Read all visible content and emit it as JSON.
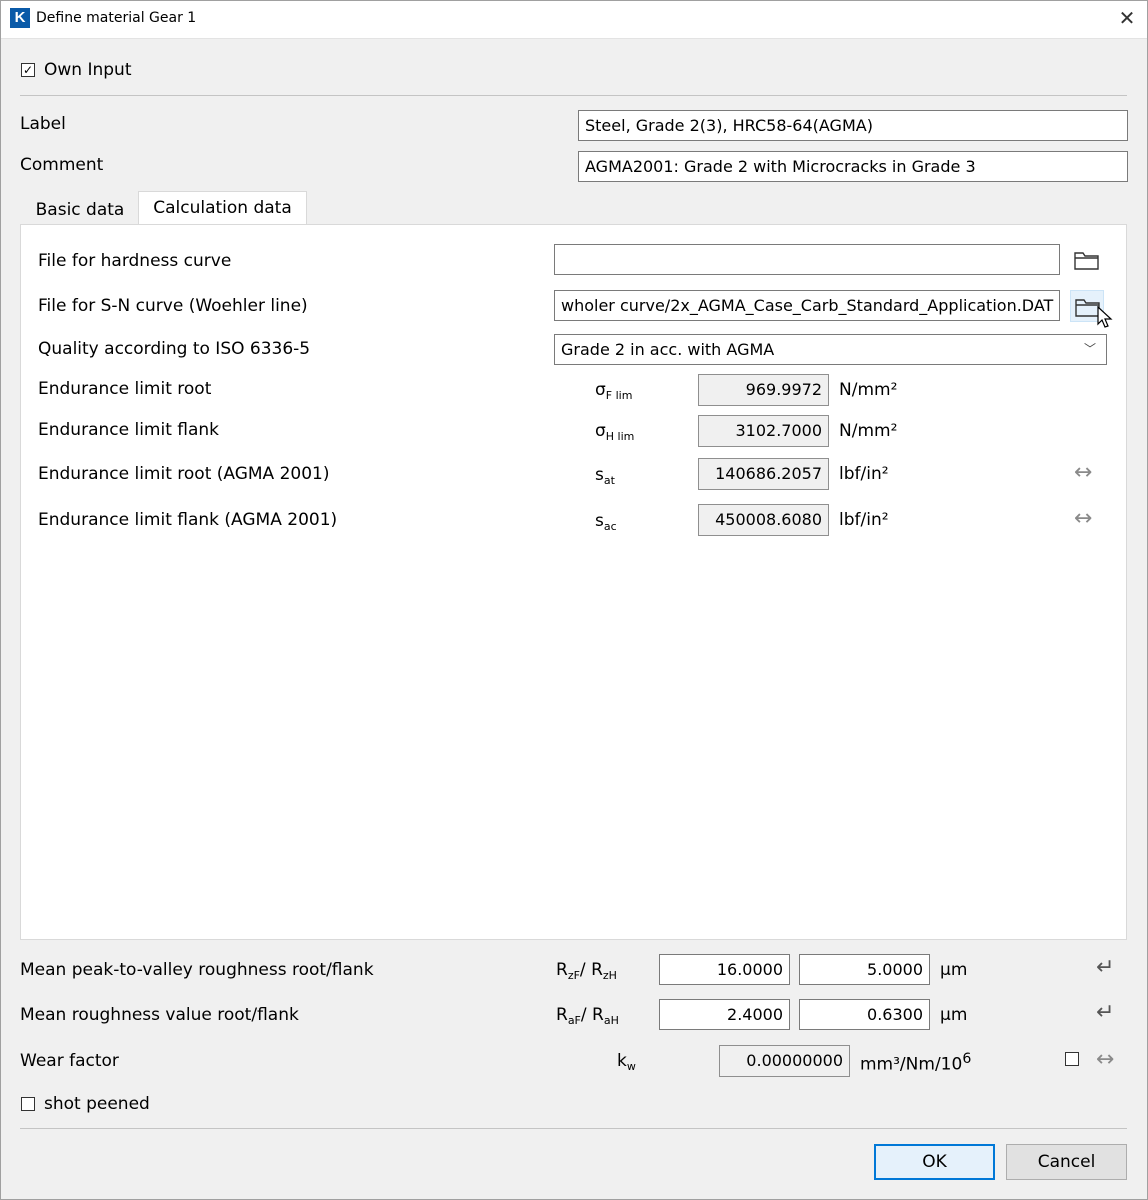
{
  "window": {
    "title": "Define material Gear 1",
    "app_icon_letter": "K",
    "close_glyph": "✕"
  },
  "own_input": {
    "label": "Own Input",
    "checked": true
  },
  "fields": {
    "label": {
      "label": "Label",
      "value": "Steel, Grade 2(3), HRC58-64(AGMA)"
    },
    "comment": {
      "label": "Comment",
      "value": "AGMA2001: Grade 2 with Microcracks in Grade 3"
    }
  },
  "tabs": [
    {
      "label": "Basic data",
      "active": false
    },
    {
      "label": "Calculation data",
      "active": true
    }
  ],
  "calc": {
    "hardness_curve": {
      "label": "File for hardness curve",
      "value": ""
    },
    "sn_curve": {
      "label": "File for S-N curve (Woehler line)",
      "value": "wholer curve/2x_AGMA_Case_Carb_Standard_Application.DAT"
    },
    "quality": {
      "label": "Quality according to ISO 6336-5",
      "selected": "Grade 2 in acc. with AGMA"
    },
    "rows": [
      {
        "label": "Endurance limit root",
        "sym": "σ",
        "sub": "F lim",
        "value": "969.9972",
        "unit": "N/mm²"
      },
      {
        "label": "Endurance limit flank",
        "sym": "σ",
        "sub": "H lim",
        "value": "3102.7000",
        "unit": "N/mm²"
      },
      {
        "label": "Endurance limit root (AGMA 2001)",
        "sym": "s",
        "sub": "at",
        "value": "140686.2057",
        "unit": "lbf/in²"
      },
      {
        "label": "Endurance limit flank (AGMA 2001)",
        "sym": "s",
        "sub": "ac",
        "value": "450008.6080",
        "unit": "lbf/in²"
      }
    ]
  },
  "roughness": {
    "peak": {
      "label": "Mean peak-to-valley roughness root/flank",
      "sym1": "R",
      "sub1": "zF",
      "sep": "/ ",
      "sym2": "R",
      "sub2": "zH",
      "v1": "16.0000",
      "v2": "5.0000",
      "unit": "μm"
    },
    "mean": {
      "label": "Mean roughness value root/flank",
      "sym1": "R",
      "sub1": "aF",
      "sep": "/ ",
      "sym2": "R",
      "sub2": "aH",
      "v1": "2.4000",
      "v2": "0.6300",
      "unit": "μm"
    }
  },
  "wear": {
    "label": "Wear factor",
    "sym": "k",
    "sub": "w",
    "value": "0.00000000",
    "unit_base": "mm³/Nm/10",
    "unit_sup": "6"
  },
  "shot_peened": {
    "label": "shot peened",
    "checked": false
  },
  "buttons": {
    "ok": "OK",
    "cancel": "Cancel"
  },
  "icons": {
    "folder": "folder-icon",
    "convert": "double-arrow-icon",
    "enter": "enter-icon"
  }
}
